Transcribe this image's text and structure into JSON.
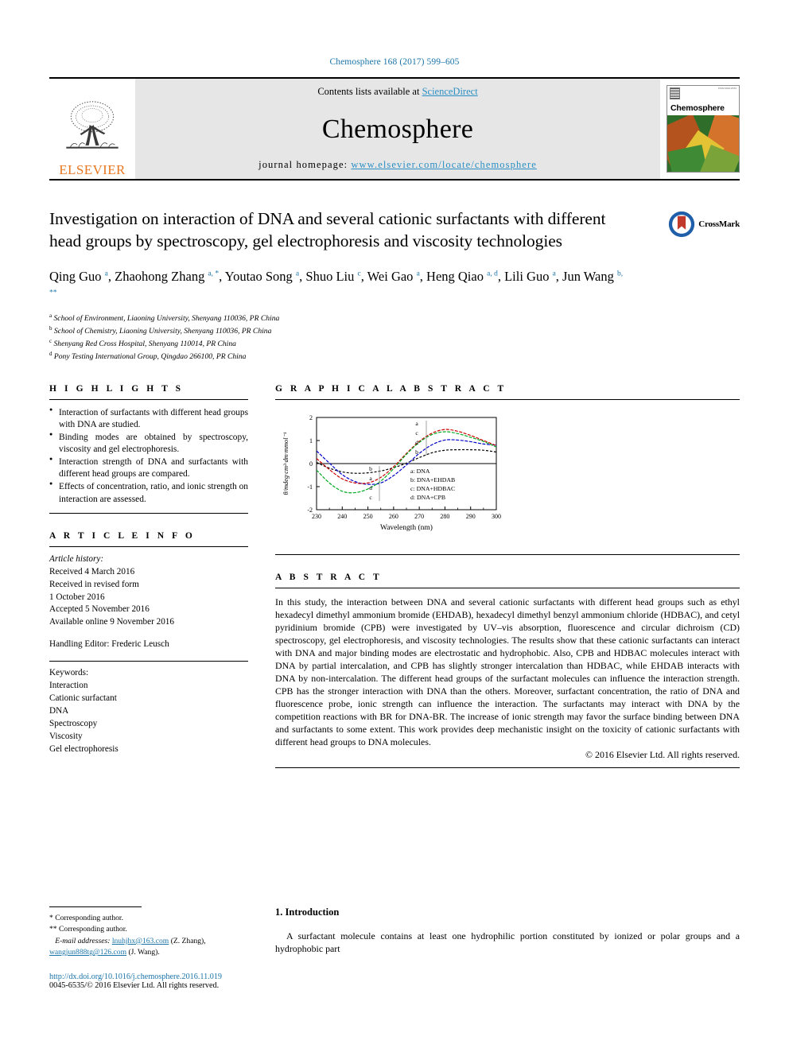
{
  "running_head": "Chemosphere 168 (2017) 599–605",
  "masthead": {
    "contents_prefix": "Contents lists available at ",
    "sciencedirect": "ScienceDirect",
    "journal_name": "Chemosphere",
    "homepage_prefix": "journal homepage: ",
    "homepage_url": "www.elsevier.com/locate/chemosphere",
    "publisher": "ELSEVIER",
    "cover_title": "Chemosphere",
    "cover_tiny": "ISSN 0045-6535"
  },
  "crossmark": {
    "label": "CrossMark"
  },
  "title": "Investigation on interaction of DNA and several cationic surfactants with different head groups by spectroscopy, gel electrophoresis and viscosity technologies",
  "authors_html": "Qing Guo <sup>a</sup>, Zhaohong Zhang <sup>a, *</sup>, Youtao Song <sup>a</sup>, Shuo Liu <sup>c</sup>, Wei Gao <sup>a</sup>, Heng Qiao <sup>a, d</sup>, Lili Guo <sup>a</sup>, Jun Wang <sup>b, **</sup>",
  "affiliations": [
    {
      "mark": "a",
      "text": "School of Environment, Liaoning University, Shenyang 110036, PR China"
    },
    {
      "mark": "b",
      "text": "School of Chemistry, Liaoning University, Shenyang 110036, PR China"
    },
    {
      "mark": "c",
      "text": "Shenyang Red Cross Hospital, Shenyang 110014, PR China"
    },
    {
      "mark": "d",
      "text": "Pony Testing International Group, Qingdao 266100, PR China"
    }
  ],
  "highlights": {
    "heading": "H I G H L I G H T S",
    "items": [
      "Interaction of surfactants with different head groups with DNA are studied.",
      "Binding modes are obtained by spectroscopy, viscosity and gel electrophoresis.",
      "Interaction strength of DNA and surfactants with different head groups are compared.",
      "Effects of concentration, ratio, and ionic strength on interaction are assessed."
    ]
  },
  "graphical_abstract": {
    "heading": "G R A P H I C A L   A B S T R A C T"
  },
  "article_info": {
    "heading": "A R T I C L E   I N F O",
    "history_label": "Article history:",
    "history": [
      "Received 4 March 2016",
      "Received in revised form",
      "1 October 2016",
      "Accepted 5 November 2016",
      "Available online 9 November 2016"
    ],
    "handling_editor": "Handling Editor: Frederic Leusch",
    "keywords_label": "Keywords:",
    "keywords": [
      "Interaction",
      "Cationic surfactant",
      "DNA",
      "Spectroscopy",
      "Viscosity",
      "Gel electrophoresis"
    ]
  },
  "abstract": {
    "heading": "A B S T R A C T",
    "text": "In this study, the interaction between DNA and several cationic surfactants with different head groups such as ethyl hexadecyl dimethyl ammonium bromide (EHDAB), hexadecyl dimethyl benzyl ammonium chloride (HDBAC), and cetyl pyridinium bromide (CPB) were investigated by UV–vis absorption, fluorescence and circular dichroism (CD) spectroscopy, gel electrophoresis, and viscosity technologies. The results show that these cationic surfactants can interact with DNA and major binding modes are electrostatic and hydrophobic. Also, CPB and HDBAC molecules interact with DNA by partial intercalation, and CPB has slightly stronger intercalation than HDBAC, while EHDAB interacts with DNA by non-intercalation. The different head groups of the surfactant molecules can influence the interaction strength. CPB has the stronger interaction with DNA than the others. Moreover, surfactant concentration, the ratio of DNA and fluorescence probe, ionic strength can influence the interaction. The surfactants may interact with DNA by the competition reactions with BR for DNA-BR. The increase of ionic strength may favor the surface binding between DNA and surfactants to some extent. This work provides deep mechanistic insight on the toxicity of cationic surfactants with different head groups to DNA molecules.",
    "copyright": "© 2016 Elsevier Ltd. All rights reserved."
  },
  "footer": {
    "corr1": "* Corresponding author.",
    "corr2": "** Corresponding author.",
    "email_label": "E-mail addresses:",
    "email1": "lnuhjhx@163.com",
    "email1_attr": "(Z. Zhang),",
    "email2": "wangjun888tg@126.com",
    "email2_attr": "(J. Wang).",
    "doi": "http://dx.doi.org/10.1016/j.chemosphere.2016.11.019",
    "issn": "0045-6535/© 2016 Elsevier Ltd. All rights reserved."
  },
  "introduction": {
    "heading": "1. Introduction",
    "paragraph": "A surfactant molecule contains at least one hydrophilic portion constituted by ionized or polar groups and a hydrophobic part"
  },
  "chart_data": {
    "type": "line",
    "title": "",
    "xlabel": "Wavelength (nm)",
    "ylabel": "θ/mdeg·cm²·dm·mmol⁻¹",
    "xlim": [
      230,
      300
    ],
    "ylim": [
      -2,
      2
    ],
    "xticks": [
      230,
      240,
      250,
      260,
      270,
      280,
      290,
      300
    ],
    "yticks": [
      -2,
      -1,
      0,
      1,
      2
    ],
    "grid": false,
    "legend_position": "inside-lower-right",
    "legend": [
      {
        "key": "a",
        "label": "a: DNA",
        "color": "#000000"
      },
      {
        "key": "b",
        "label": "b: DNA+EHDAB",
        "color": "#0000cc"
      },
      {
        "key": "c",
        "label": "c: DNA+HDBAC",
        "color": "#cc0000"
      },
      {
        "key": "d",
        "label": "d: DNA+CPB",
        "color": "#00aa22"
      }
    ],
    "annotations_top": [
      "a",
      "c",
      "d",
      "b"
    ],
    "annotations_bottom": [
      "b",
      "a",
      "d",
      "c"
    ],
    "x": [
      230,
      235,
      240,
      245,
      250,
      255,
      260,
      265,
      270,
      275,
      280,
      285,
      290,
      295,
      300
    ],
    "series": [
      {
        "name": "a: DNA",
        "color": "#000000",
        "values": [
          0.05,
          -0.2,
          -0.36,
          -0.42,
          -0.4,
          -0.32,
          -0.18,
          0.02,
          0.26,
          0.47,
          0.58,
          0.6,
          0.6,
          0.58,
          0.5
        ]
      },
      {
        "name": "b: DNA+EHDAB",
        "color": "#0000cc",
        "values": [
          0.55,
          0.02,
          -0.48,
          -0.78,
          -0.9,
          -0.84,
          -0.52,
          -0.06,
          0.44,
          0.82,
          1.02,
          1.02,
          0.95,
          0.85,
          0.8
        ]
      },
      {
        "name": "c: DNA+HDBAC",
        "color": "#cc0000",
        "values": [
          0.22,
          -0.26,
          -0.66,
          -0.84,
          -0.84,
          -0.6,
          -0.14,
          0.44,
          0.96,
          1.32,
          1.48,
          1.4,
          1.22,
          1.0,
          0.78
        ]
      },
      {
        "name": "d: DNA+CPB",
        "color": "#00aa22",
        "values": [
          -0.28,
          -0.84,
          -1.2,
          -1.26,
          -1.1,
          -0.76,
          -0.22,
          0.4,
          0.92,
          1.26,
          1.38,
          1.3,
          1.14,
          0.96,
          0.72
        ]
      }
    ]
  }
}
